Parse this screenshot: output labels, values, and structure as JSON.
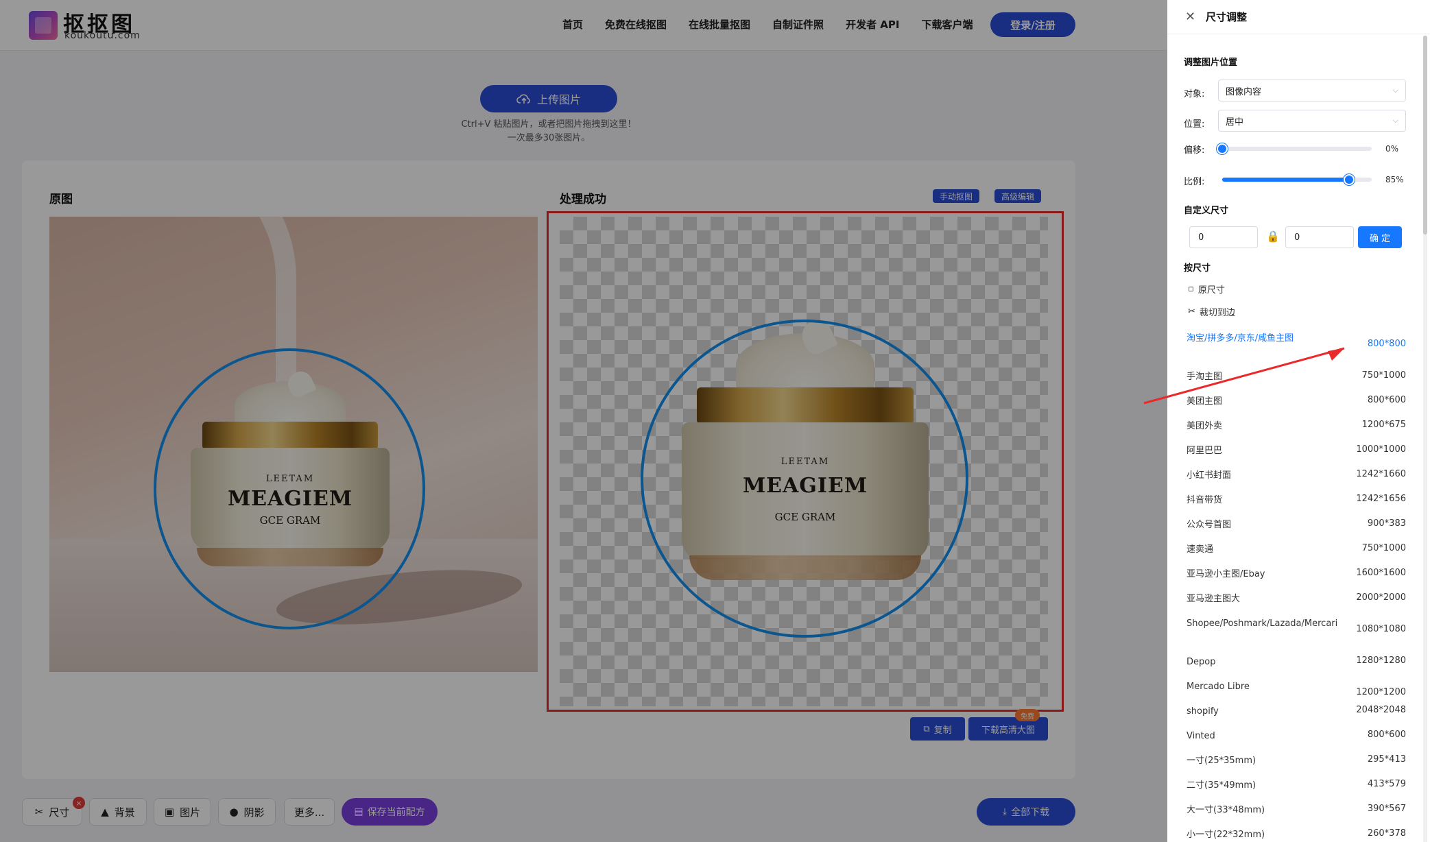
{
  "header": {
    "logo_title": "抠抠图",
    "logo_sub": "koukoutu.com",
    "nav": [
      "首页",
      "免费在线抠图",
      "在线批量抠图",
      "自制证件照",
      "开发者 API",
      "下载客户端"
    ],
    "login": "登录/注册"
  },
  "upload": {
    "button": "上传图片",
    "hint1": "Ctrl+V 粘贴图片，或者把图片拖拽到这里！",
    "hint2": "一次最多30张图片。"
  },
  "workspace": {
    "orig_title": "原图",
    "result_title": "处理成功",
    "manual_btn": "手动抠图",
    "advanced_btn": "高级编辑",
    "copy_btn": "复制",
    "download_hd_btn": "下载高清大图",
    "free_badge": "免费",
    "jar_line1": "LEETAM",
    "jar_line2": "MEAGIEM",
    "jar_line3": "GCE GRAM"
  },
  "toolbar": {
    "size": "尺寸",
    "background": "背景",
    "image": "图片",
    "shadow": "阴影",
    "more": "更多...",
    "save_recipe": "保存当前配方",
    "download_all": "全部下载",
    "close_mark": "×"
  },
  "panel": {
    "title": "尺寸调整",
    "section_position": "调整图片位置",
    "target_label": "对象:",
    "target_value": "图像内容",
    "position_label": "位置:",
    "position_value": "居中",
    "offset_label": "偏移:",
    "offset_value": "0%",
    "offset_level": 0,
    "scale_label": "比例:",
    "scale_value": "85%",
    "scale_level": 0.85,
    "section_custom": "自定义尺寸",
    "width_value": "0",
    "height_value": "0",
    "confirm": "确 定",
    "section_by_size": "按尺寸",
    "original_size": "原尺寸",
    "crop_to_edge": "裁切到边",
    "presets": [
      {
        "name": "淘宝/拼多多/京东/咸鱼主图",
        "size": "800*800",
        "active": true
      },
      {
        "name": "手淘主图",
        "size": "750*1000"
      },
      {
        "name": "美团主图",
        "size": "800*600"
      },
      {
        "name": "美团外卖",
        "size": "1200*675"
      },
      {
        "name": "阿里巴巴",
        "size": "1000*1000"
      },
      {
        "name": "小红书封面",
        "size": "1242*1660"
      },
      {
        "name": "抖音带货",
        "size": "1242*1656"
      },
      {
        "name": "公众号首图",
        "size": "900*383"
      },
      {
        "name": "速卖通",
        "size": "750*1000"
      },
      {
        "name": "亚马逊小主图/Ebay",
        "size": "1600*1600"
      },
      {
        "name": "亚马逊主图大",
        "size": "2000*2000"
      },
      {
        "name": "Shopee/Poshmark/Lazada/Mercari",
        "size": "1080*1080"
      },
      {
        "name": "Depop",
        "size": "1280*1280"
      },
      {
        "name": "Mercado Libre",
        "size": "1200*1200"
      },
      {
        "name": "shopify",
        "size": "2048*2048"
      },
      {
        "name": "Vinted",
        "size": "800*600"
      },
      {
        "name": "一寸(25*35mm)",
        "size": "295*413"
      },
      {
        "name": "二寸(35*49mm)",
        "size": "413*579"
      },
      {
        "name": "大一寸(33*48mm)",
        "size": "390*567"
      },
      {
        "name": "小一寸(22*32mm)",
        "size": "260*378"
      }
    ]
  },
  "colors": {
    "accent": "#2a4bd7",
    "panel_accent": "#1677ff",
    "highlight_frame": "#ea2a2a",
    "ring": "#1590f0",
    "recipe": "#7a3fe0"
  }
}
